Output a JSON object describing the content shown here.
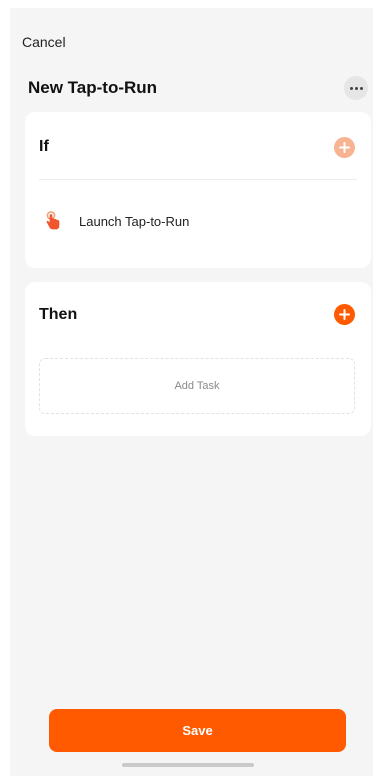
{
  "header": {
    "cancel_label": "Cancel",
    "title": "New Tap-to-Run",
    "more_icon": "more-horizontal-icon"
  },
  "if_section": {
    "heading": "If",
    "add_icon": "plus-icon",
    "add_color": "#f7b392",
    "condition": {
      "icon": "hand-tap-icon",
      "label": "Launch Tap-to-Run"
    }
  },
  "then_section": {
    "heading": "Then",
    "add_icon": "plus-icon",
    "add_color": "#ff5a00",
    "add_task_label": "Add Task"
  },
  "footer": {
    "save_label": "Save"
  },
  "colors": {
    "accent": "#ff5a00",
    "background": "#f5f5f5",
    "card": "#ffffff"
  }
}
